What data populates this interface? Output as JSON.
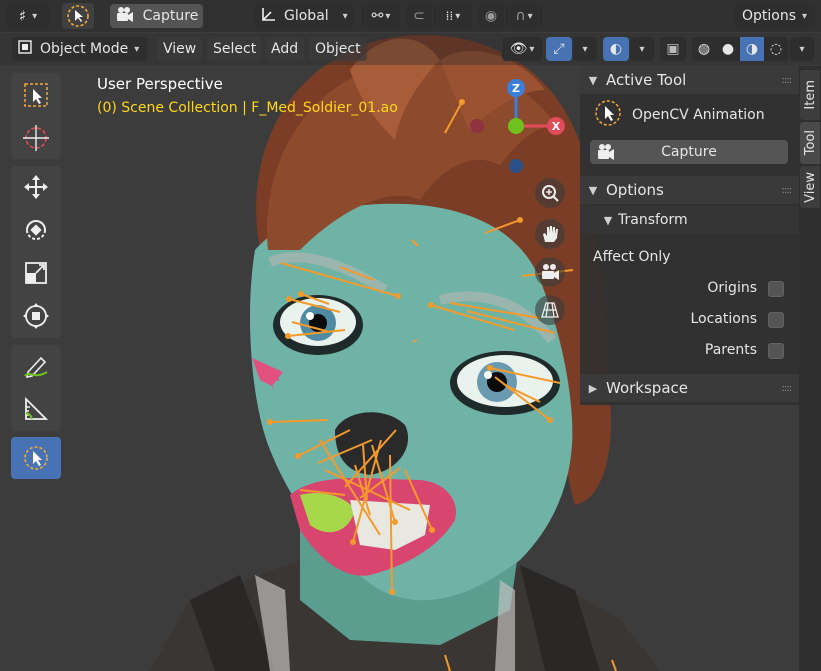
{
  "header": {
    "editor_type_icon": "grid-editor-icon",
    "capture_label": "Capture",
    "orientation_label": "Global",
    "options_label": "Options"
  },
  "subheader": {
    "mode_label": "Object Mode",
    "menus": [
      "View",
      "Select",
      "Add",
      "Object"
    ]
  },
  "viewport": {
    "perspective_label": "User Perspective",
    "collection_label": "(0) Scene Collection | F_Med_Soldier_01.ao"
  },
  "gizmo": {
    "z": "Z",
    "x": "X"
  },
  "sidebar": {
    "tabs": [
      "Item",
      "Tool",
      "View"
    ],
    "active_tab": "Tool",
    "active_tool": {
      "header": "Active Tool",
      "tool_name": "OpenCV Animation",
      "capture_button": "Capture"
    },
    "options": {
      "header": "Options",
      "transform_header": "Transform",
      "affect_only_label": "Affect Only",
      "items": [
        {
          "label": "Origins",
          "checked": false
        },
        {
          "label": "Locations",
          "checked": false
        },
        {
          "label": "Parents",
          "checked": false
        }
      ]
    },
    "workspace": {
      "header": "Workspace"
    }
  },
  "colors": {
    "accent_blue": "#4772b3",
    "collection_text": "#ffd71a",
    "landmark_lines": "#f49a2b",
    "axis_x": "#e14b5a",
    "axis_y": "#6fc11d",
    "axis_z": "#3b7fd8"
  }
}
